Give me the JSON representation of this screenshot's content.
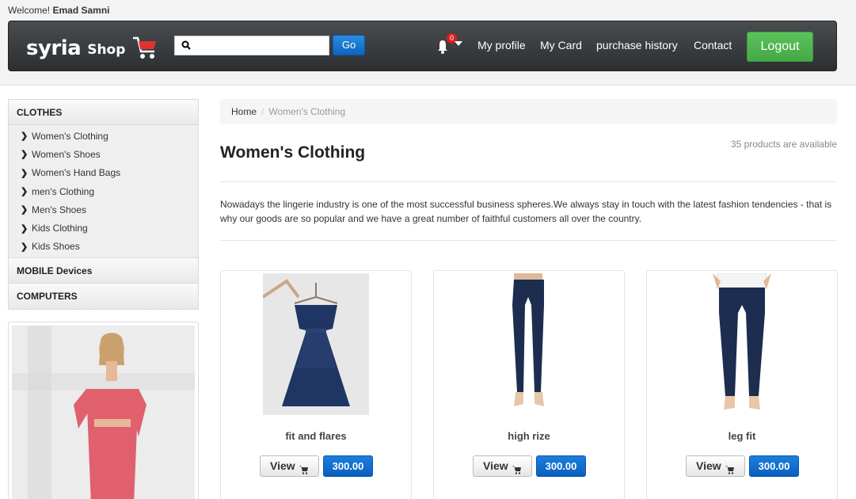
{
  "header": {
    "welcome_prefix": "Welcome!",
    "username": "Emad Samni",
    "logo_word1": "syria",
    "logo_word2": "Shop",
    "search": {
      "value": "",
      "placeholder": ""
    },
    "go_label": "Go",
    "notification_count": "0",
    "nav": [
      "My profile",
      "My Card",
      "purchase history",
      "Contact"
    ],
    "logout_label": "Logout"
  },
  "sidebar": {
    "categories": [
      {
        "title": "CLOTHES",
        "items": [
          "Women's Clothing",
          "Women's Shoes",
          "Women's Hand Bags",
          "men's Clothing",
          "Men's Shoes",
          "Kids Clothing",
          "Kids Shoes"
        ]
      },
      {
        "title": "MOBILE Devices",
        "items": []
      },
      {
        "title": "COMPUTERS",
        "items": []
      }
    ]
  },
  "main": {
    "breadcrumb": {
      "home": "Home",
      "separator": "/",
      "current": "Women's Clothing"
    },
    "title": "Women's Clothing",
    "count_text": "35 products are available",
    "description": "Nowadays the lingerie industry is one of the most successful business spheres.We always stay in touch with the latest fashion tendencies - that is why our goods are so popular and we have a great number of faithful customers all over the country.",
    "products": [
      {
        "name": "fit and flares",
        "view_label": "View",
        "price": "300.00"
      },
      {
        "name": "high rize",
        "view_label": "View",
        "price": "300.00"
      },
      {
        "name": "leg fit",
        "view_label": "View",
        "price": "300.00"
      }
    ]
  },
  "colors": {
    "navbar_dark": "#2c2f32",
    "go_blue": "#0b66c2",
    "logout_green": "#45a845",
    "badge_red": "#d81e1e",
    "cart_red": "#e53030",
    "dress_navy": "#1f3563",
    "jeans_blue": "#1c2d4f",
    "promo_dress_pink": "#e0606e"
  },
  "icons": [
    "shopping-cart-icon",
    "search-icon",
    "bell-icon",
    "chevron-right-icon",
    "cart-icon"
  ]
}
